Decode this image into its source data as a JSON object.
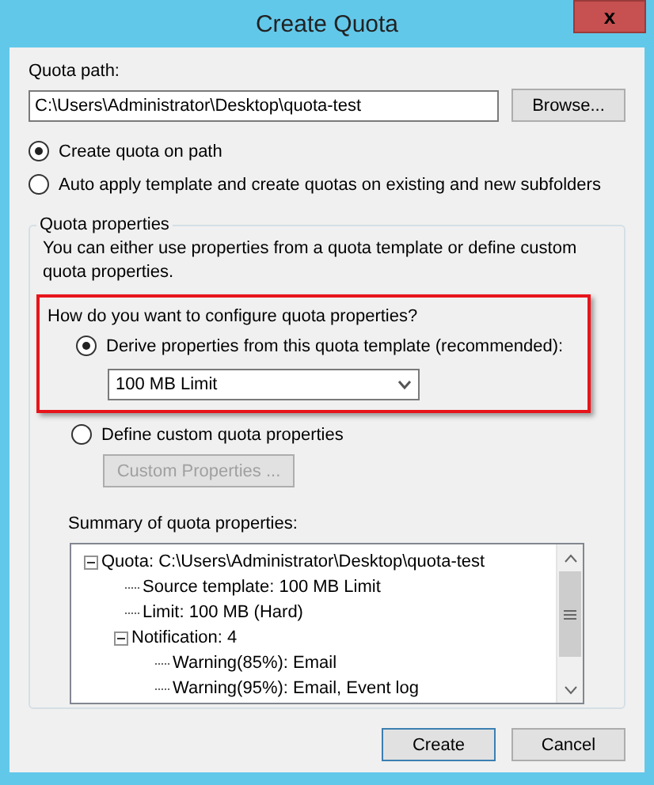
{
  "window": {
    "title": "Create Quota",
    "close": "x"
  },
  "quota_path": {
    "label": "Quota path:",
    "value": "C:\\Users\\Administrator\\Desktop\\quota-test",
    "browse": "Browse..."
  },
  "apply_options": [
    {
      "label": "Create quota on path",
      "selected": true
    },
    {
      "label": "Auto apply template and create quotas on existing and new subfolders",
      "selected": false
    }
  ],
  "quota_properties": {
    "legend": "Quota properties",
    "description": "You can either use properties from a quota template or define custom quota properties.",
    "question": "How do you want to configure quota properties?",
    "derive": {
      "label": "Derive properties from this quota template (recommended):",
      "selected": true,
      "template": "100 MB Limit"
    },
    "custom": {
      "label": "Define custom quota properties",
      "selected": false,
      "button": "Custom Properties ...",
      "disabled": true
    },
    "summary_label": "Summary of quota properties:",
    "summary_tree": [
      {
        "label": "Quota: C:\\Users\\Administrator\\Desktop\\quota-test",
        "expanded": true,
        "children": [
          {
            "label": "Source template: 100 MB Limit"
          },
          {
            "label": "Limit: 100 MB (Hard)"
          },
          {
            "label": "Notification: 4",
            "expanded": true,
            "children": [
              {
                "label": "Warning(85%): Email"
              },
              {
                "label": "Warning(95%): Email, Event log"
              }
            ]
          }
        ]
      }
    ]
  },
  "buttons": [
    {
      "label": "Create",
      "default": true
    },
    {
      "label": "Cancel",
      "default": false
    }
  ]
}
